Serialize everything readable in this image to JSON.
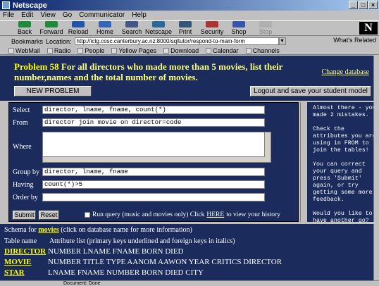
{
  "window": {
    "title": "Netscape"
  },
  "menu": [
    "File",
    "Edit",
    "View",
    "Go",
    "Communicator",
    "Help"
  ],
  "toolbar": [
    {
      "label": "Back",
      "icon": "back-arrow-icon",
      "color": "#1e8a3a",
      "disabled": false
    },
    {
      "label": "Forward",
      "icon": "forward-arrow-icon",
      "color": "#1e8a3a",
      "disabled": false
    },
    {
      "label": "Reload",
      "icon": "reload-icon",
      "color": "#2255aa",
      "disabled": false
    },
    {
      "label": "Home",
      "icon": "home-icon",
      "color": "#3366bb",
      "disabled": false
    },
    {
      "label": "Search",
      "icon": "search-icon",
      "color": "#445588",
      "disabled": false
    },
    {
      "label": "Netscape",
      "icon": "netscape-icon",
      "color": "#2a6a9a",
      "disabled": false
    },
    {
      "label": "Print",
      "icon": "print-icon",
      "color": "#335577",
      "disabled": false
    },
    {
      "label": "Security",
      "icon": "lock-icon",
      "color": "#aa3333",
      "disabled": false
    },
    {
      "label": "Shop",
      "icon": "shop-icon",
      "color": "#3355aa",
      "disabled": false
    },
    {
      "label": "Stop",
      "icon": "stop-icon",
      "color": "#b0b0b0",
      "disabled": true
    }
  ],
  "location": {
    "bookmarks_label": "Bookmarks",
    "location_label": "Location:",
    "url": "http://ictg.cosc.canterbury.ac.nz:8000/sqltutor/respond-to-main-form",
    "whats_related": "What's Related"
  },
  "personal_toolbar": [
    "WebMail",
    "Radio",
    "People",
    "Yellow Pages",
    "Download",
    "Calendar",
    "Channels"
  ],
  "problem": {
    "number": "Problem 58",
    "text": "For all directors who made more than 5 movies, list their number,names and the total number of movies.",
    "change_database": "Change database",
    "new_problem": "NEW PROBLEM",
    "logout": "Logout and save your student model"
  },
  "form": {
    "select_label": "Select",
    "select_value": "director, lname, fname, count(*)",
    "from_label": "From",
    "from_value": "director join movie on director=code",
    "where_label": "Where",
    "where_value": "",
    "groupby_label": "Group by",
    "groupby_value": "director, lname, fname",
    "having_label": "Having",
    "having_value": "count(*)>5",
    "orderby_label": "Order by",
    "orderby_value": "",
    "submit": "Submit",
    "reset": "Reset",
    "run_query_text": "Run query (music and movies only) Click",
    "here": "HERE",
    "run_query_suffix": "to view your history"
  },
  "feedback": "Almost there - you\nmade 2 mistakes.\n\nCheck the\nattributes you are\nusing in FROM to\njoin the tables!\n\nYou can correct\nyour query and\npress 'Submit'\nagain, or try\ngetting some more\nfeedback.\n\nWould you like to\nhave another go?",
  "schema": {
    "intro": "Schema for",
    "db_name": "movies",
    "intro_suffix": "(click on database name for more information)",
    "table_name_header": "Table name",
    "attr_header": "Attribute list (primary keys underlined and foreign keys in italics)",
    "tables": [
      {
        "name": "DIRECTOR",
        "attrs": "NUMBER LNAME FNAME BORN DIED"
      },
      {
        "name": "MOVIE",
        "attrs": "NUMBER TITLE TYPE AANOM AAWON YEAR CRITICS DIRECTOR"
      },
      {
        "name": "STAR",
        "attrs": "LNAME FNAME NUMBER BORN DIED CITY"
      }
    ]
  },
  "status": {
    "text": "Document: Done"
  }
}
